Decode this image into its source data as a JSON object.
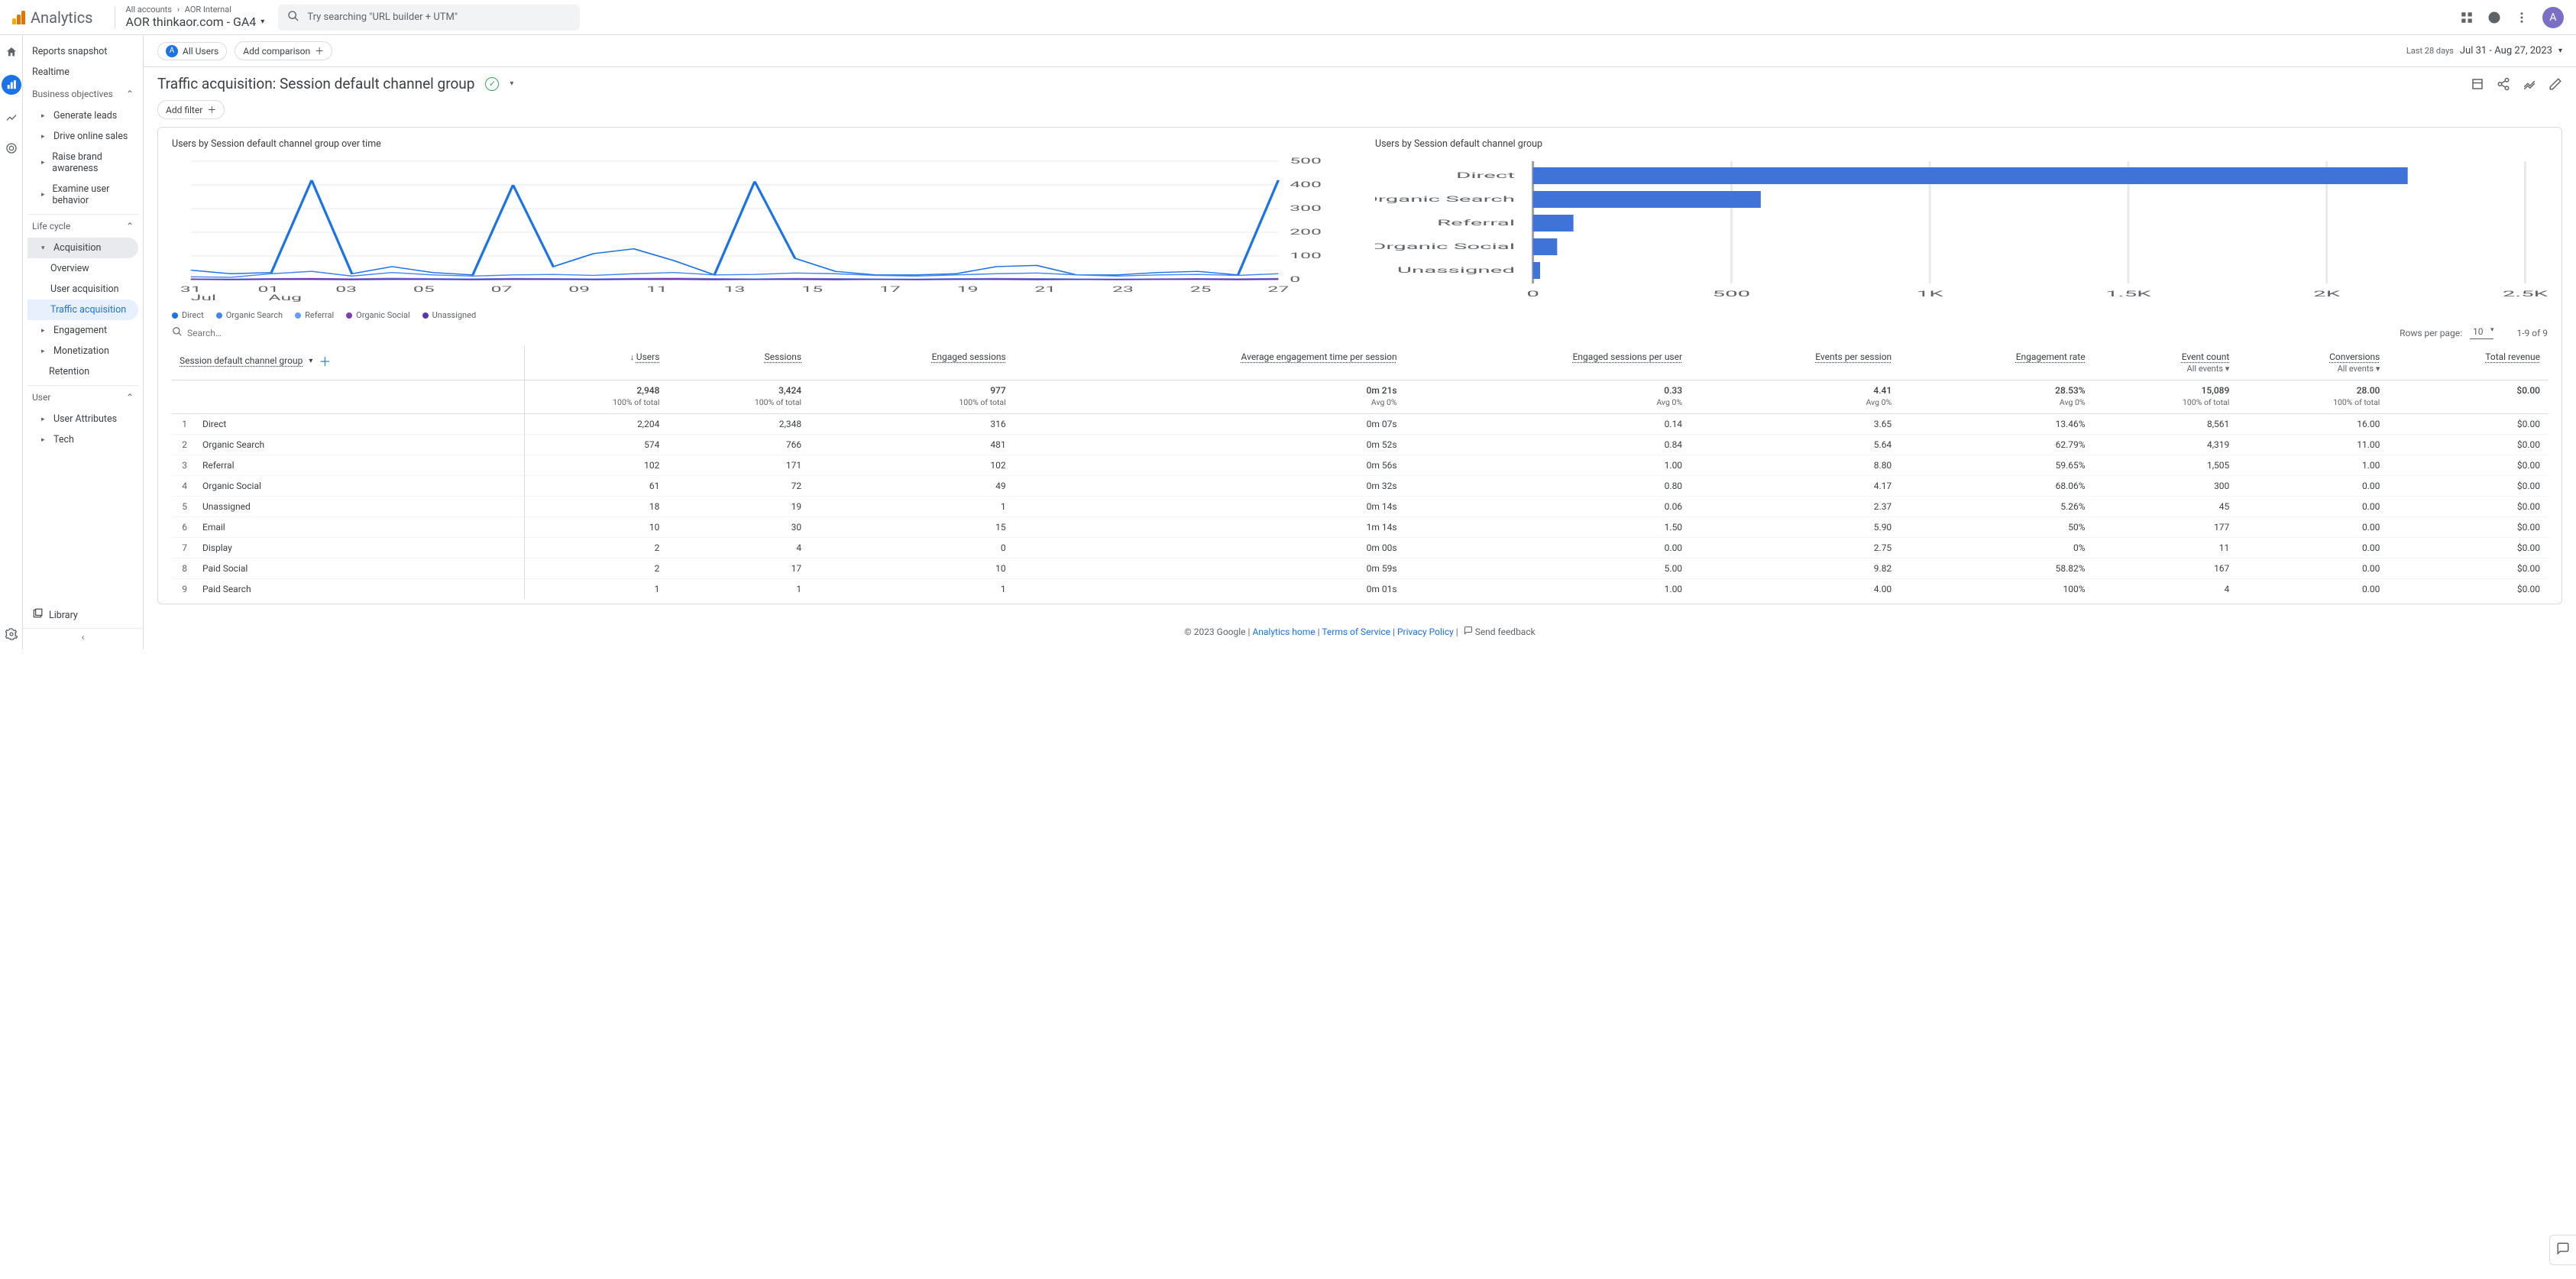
{
  "app_name": "Analytics",
  "breadcrumb": {
    "l1": "All accounts",
    "l2": "AOR Internal",
    "property": "AOR thinkaor.com - GA4"
  },
  "search_placeholder": "Try searching \"URL builder + UTM\"",
  "avatar_letter": "A",
  "sidebar": {
    "reports_snapshot": "Reports snapshot",
    "realtime": "Realtime",
    "business_objectives": "Business objectives",
    "generate_leads": "Generate leads",
    "drive_online_sales": "Drive online sales",
    "raise_brand": "Raise brand awareness",
    "examine_behavior": "Examine user behavior",
    "life_cycle": "Life cycle",
    "acquisition": "Acquisition",
    "overview": "Overview",
    "user_acq": "User acquisition",
    "traffic_acq": "Traffic acquisition",
    "engagement": "Engagement",
    "monetization": "Monetization",
    "retention": "Retention",
    "user": "User",
    "user_attributes": "User Attributes",
    "tech": "Tech",
    "library": "Library"
  },
  "comparison": {
    "all_users": "All Users",
    "add": "Add comparison"
  },
  "date": {
    "label": "Last 28 days",
    "range": "Jul 31 - Aug 27, 2023"
  },
  "page_title": "Traffic acquisition: Session default channel group",
  "add_filter": "Add filter",
  "chart1_title": "Users by Session default channel group over time",
  "chart2_title": "Users by Session default channel group",
  "legend": [
    "Direct",
    "Organic Search",
    "Referral",
    "Organic Social",
    "Unassigned"
  ],
  "colors": {
    "direct": "#1a73e8",
    "organic_search": "#4285f4",
    "referral": "#669df6",
    "organic_social": "#7b3fb3",
    "unassigned": "#5e35b1"
  },
  "chart_data": {
    "line": {
      "type": "line",
      "x_ticks": [
        "31",
        "01",
        "03",
        "05",
        "07",
        "09",
        "11",
        "13",
        "15",
        "17",
        "19",
        "21",
        "23",
        "25",
        "27"
      ],
      "x_sublabels": [
        "Jul",
        "Aug"
      ],
      "ylim": [
        0,
        500
      ],
      "y_ticks": [
        0,
        100,
        200,
        300,
        400,
        500
      ],
      "series": [
        {
          "name": "Direct",
          "color": "#1a73e8",
          "values": [
            40,
            25,
            30,
            420,
            25,
            55,
            30,
            20,
            400,
            55,
            110,
            130,
            80,
            20,
            415,
            90,
            35,
            20,
            20,
            25,
            55,
            60,
            20,
            20,
            30,
            35,
            20,
            420
          ]
        },
        {
          "name": "Organic Search",
          "color": "#4285f4",
          "values": [
            12,
            10,
            25,
            35,
            15,
            30,
            20,
            15,
            20,
            22,
            18,
            25,
            30,
            20,
            22,
            28,
            25,
            18,
            15,
            20,
            25,
            28,
            20,
            15,
            20,
            22,
            18,
            25
          ]
        },
        {
          "name": "Referral",
          "color": "#669df6",
          "values": [
            3,
            2,
            4,
            5,
            3,
            6,
            4,
            3,
            5,
            4,
            3,
            5,
            6,
            4,
            3,
            5,
            4,
            3,
            2,
            4,
            5,
            4,
            3,
            2,
            3,
            4,
            3,
            5
          ]
        },
        {
          "name": "Organic Social",
          "color": "#7b3fb3",
          "values": [
            2,
            1,
            3,
            4,
            2,
            3,
            2,
            1,
            3,
            2,
            1,
            3,
            4,
            2,
            1,
            3,
            2,
            1,
            1,
            2,
            3,
            2,
            1,
            1,
            2,
            3,
            2,
            3
          ]
        },
        {
          "name": "Unassigned",
          "color": "#5e35b1",
          "values": [
            1,
            0,
            1,
            1,
            0,
            1,
            1,
            0,
            1,
            1,
            0,
            1,
            1,
            0,
            1,
            1,
            0,
            1,
            0,
            1,
            1,
            0,
            1,
            0,
            1,
            1,
            0,
            1
          ]
        }
      ]
    },
    "bar": {
      "type": "bar",
      "xlim": [
        0,
        2500
      ],
      "x_ticks": [
        0,
        500,
        "1K",
        "1.5K",
        "2K",
        "2.5K"
      ],
      "categories": [
        "Direct",
        "Organic Search",
        "Referral",
        "Organic Social",
        "Unassigned"
      ],
      "values": [
        2204,
        574,
        102,
        61,
        18
      ],
      "color": "#4073d8"
    }
  },
  "table_controls": {
    "search_placeholder": "Search…",
    "rows_per_page_label": "Rows per page:",
    "rows_per_page": "10",
    "range": "1-9 of 9"
  },
  "table": {
    "dim_header": "Session default channel group",
    "columns": [
      {
        "key": "users",
        "label": "Users",
        "sort": true
      },
      {
        "key": "sessions",
        "label": "Sessions"
      },
      {
        "key": "engaged",
        "label": "Engaged sessions"
      },
      {
        "key": "aet",
        "label": "Average engagement time per session"
      },
      {
        "key": "espu",
        "label": "Engaged sessions per user"
      },
      {
        "key": "eps",
        "label": "Events per session"
      },
      {
        "key": "er",
        "label": "Engagement rate"
      },
      {
        "key": "ec",
        "label": "Event count",
        "sub": "All events"
      },
      {
        "key": "conv",
        "label": "Conversions",
        "sub": "All events"
      },
      {
        "key": "rev",
        "label": "Total revenue"
      }
    ],
    "totals": {
      "users": "2,948",
      "sessions": "3,424",
      "engaged": "977",
      "aet": "0m 21s",
      "espu": "0.33",
      "eps": "4.41",
      "er": "28.53%",
      "ec": "15,089",
      "conv": "28.00",
      "rev": "$0.00"
    },
    "totals_sub": {
      "users": "100% of total",
      "sessions": "100% of total",
      "engaged": "100% of total",
      "aet": "Avg 0%",
      "espu": "Avg 0%",
      "eps": "Avg 0%",
      "er": "Avg 0%",
      "ec": "100% of total",
      "conv": "100% of total",
      "rev": ""
    },
    "rows": [
      {
        "n": "1",
        "dim": "Direct",
        "users": "2,204",
        "sessions": "2,348",
        "engaged": "316",
        "aet": "0m 07s",
        "espu": "0.14",
        "eps": "3.65",
        "er": "13.46%",
        "ec": "8,561",
        "conv": "16.00",
        "rev": "$0.00"
      },
      {
        "n": "2",
        "dim": "Organic Search",
        "users": "574",
        "sessions": "766",
        "engaged": "481",
        "aet": "0m 52s",
        "espu": "0.84",
        "eps": "5.64",
        "er": "62.79%",
        "ec": "4,319",
        "conv": "11.00",
        "rev": "$0.00"
      },
      {
        "n": "3",
        "dim": "Referral",
        "users": "102",
        "sessions": "171",
        "engaged": "102",
        "aet": "0m 56s",
        "espu": "1.00",
        "eps": "8.80",
        "er": "59.65%",
        "ec": "1,505",
        "conv": "1.00",
        "rev": "$0.00"
      },
      {
        "n": "4",
        "dim": "Organic Social",
        "users": "61",
        "sessions": "72",
        "engaged": "49",
        "aet": "0m 32s",
        "espu": "0.80",
        "eps": "4.17",
        "er": "68.06%",
        "ec": "300",
        "conv": "0.00",
        "rev": "$0.00"
      },
      {
        "n": "5",
        "dim": "Unassigned",
        "users": "18",
        "sessions": "19",
        "engaged": "1",
        "aet": "0m 14s",
        "espu": "0.06",
        "eps": "2.37",
        "er": "5.26%",
        "ec": "45",
        "conv": "0.00",
        "rev": "$0.00"
      },
      {
        "n": "6",
        "dim": "Email",
        "users": "10",
        "sessions": "30",
        "engaged": "15",
        "aet": "1m 14s",
        "espu": "1.50",
        "eps": "5.90",
        "er": "50%",
        "ec": "177",
        "conv": "0.00",
        "rev": "$0.00"
      },
      {
        "n": "7",
        "dim": "Display",
        "users": "2",
        "sessions": "4",
        "engaged": "0",
        "aet": "0m 00s",
        "espu": "0.00",
        "eps": "2.75",
        "er": "0%",
        "ec": "11",
        "conv": "0.00",
        "rev": "$0.00"
      },
      {
        "n": "8",
        "dim": "Paid Social",
        "users": "2",
        "sessions": "17",
        "engaged": "10",
        "aet": "0m 59s",
        "espu": "5.00",
        "eps": "9.82",
        "er": "58.82%",
        "ec": "167",
        "conv": "0.00",
        "rev": "$0.00"
      },
      {
        "n": "9",
        "dim": "Paid Search",
        "users": "1",
        "sessions": "1",
        "engaged": "1",
        "aet": "0m 01s",
        "espu": "1.00",
        "eps": "4.00",
        "er": "100%",
        "ec": "4",
        "conv": "0.00",
        "rev": "$0.00"
      }
    ]
  },
  "footer": {
    "copyright": "© 2023 Google",
    "home": "Analytics home",
    "tos": "Terms of Service",
    "privacy": "Privacy Policy",
    "feedback": "Send feedback"
  }
}
